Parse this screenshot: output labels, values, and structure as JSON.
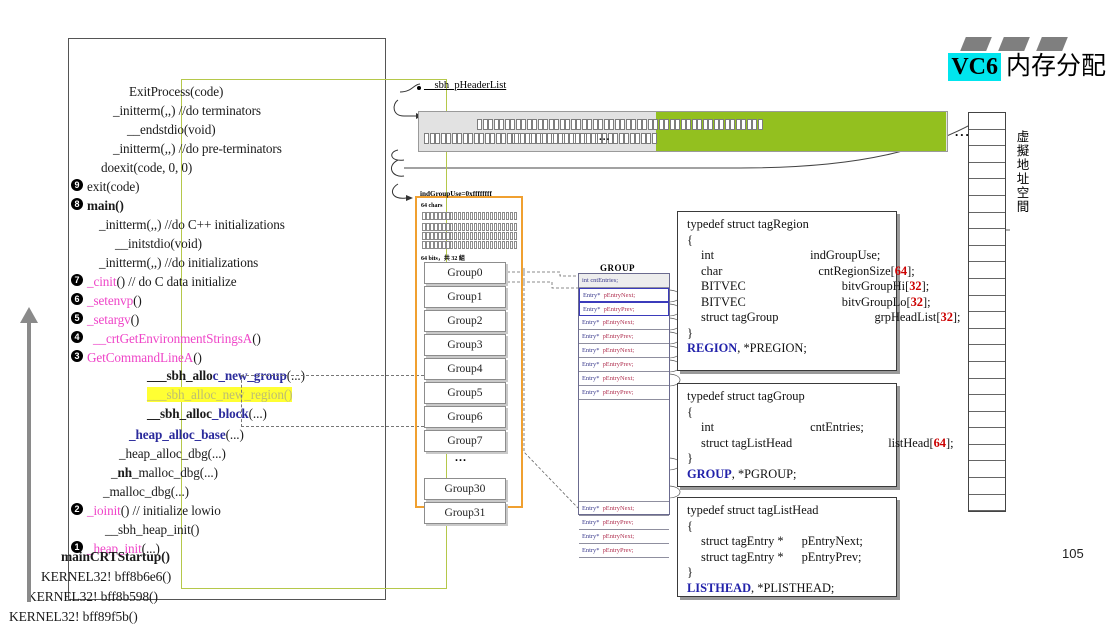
{
  "title": {
    "badge": "VC6",
    "text": "内存分配"
  },
  "page_number": "105",
  "callstack": {
    "lines": [
      {
        "text": "ExitProcess(code)",
        "indent": 60,
        "marker": ""
      },
      {
        "text": "_initterm(,,)   //do terminators",
        "indent": 44,
        "marker": ""
      },
      {
        "text": "__endstdio(void)",
        "indent": 58,
        "marker": ""
      },
      {
        "text": "_initterm(,,)   //do pre-terminators",
        "indent": 44,
        "marker": ""
      },
      {
        "text": "doexit(code, 0, 0)",
        "indent": 32,
        "marker": ""
      },
      {
        "text": "exit(code)",
        "indent": 18,
        "marker": "9"
      },
      {
        "text": "main()",
        "indent": 18,
        "marker": "8"
      },
      {
        "text": "_initterm(,,)  //do C++ initializations",
        "indent": 30,
        "marker": ""
      },
      {
        "text": "__initstdio(void)",
        "indent": 46,
        "marker": ""
      },
      {
        "text": "_initterm(,,)  //do initializations",
        "indent": 30,
        "marker": ""
      },
      {
        "text": "_cinit()  // do C data initialize",
        "indent": 18,
        "marker": "7"
      },
      {
        "text": "_setenvp()",
        "indent": 18,
        "marker": "6"
      },
      {
        "text": "_setargv()",
        "indent": 18,
        "marker": "5"
      },
      {
        "text": "__crtGetEnvironmentStringsA()",
        "indent": 24,
        "marker": "4"
      },
      {
        "text": "GetCommandLineA()",
        "indent": 18,
        "marker": "3"
      },
      {
        "text": "___sbh_alloc_new_group(...)",
        "indent": 78,
        "marker": ""
      },
      {
        "text": "___sbh_alloc_new_region()",
        "indent": 78,
        "marker": ""
      },
      {
        "text": "__sbh_alloc_block(...)",
        "indent": 78,
        "marker": ""
      },
      {
        "text": "_heap_alloc_base(...)",
        "indent": 60,
        "marker": ""
      },
      {
        "text": "_heap_alloc_dbg(...)",
        "indent": 50,
        "marker": ""
      },
      {
        "text": "_nh_malloc_dbg(...)",
        "indent": 42,
        "marker": ""
      },
      {
        "text": "_malloc_dbg(...)",
        "indent": 34,
        "marker": ""
      },
      {
        "text": "_ioinit() // initialize lowio",
        "indent": 18,
        "marker": "2"
      },
      {
        "text": "__sbh_heap_init()",
        "indent": 36,
        "marker": ""
      },
      {
        "text": "_heap_init(...)",
        "indent": 18,
        "marker": "1"
      }
    ],
    "outside_lines": [
      "mainCRTStartup()",
      "KERNEL32! bff8b6e6()",
      "KERNEL32! bff8b598()",
      "KERNEL32! bff89f5b()"
    ]
  },
  "header_list": {
    "pointer_label": "__sbh_pHeaderList",
    "dots_mid": "...",
    "dots_right": "... ..."
  },
  "virtual_address_space": {
    "label": "虚擬地址空間"
  },
  "region_box": {
    "ind_group_use": "indGroupUse=0xffffffff",
    "chars_label": "64 chars",
    "bits_label": "64 bits，共 32 組",
    "groups": [
      "Group0",
      "Group1",
      "Group2",
      "Group3",
      "Group4",
      "Group5",
      "Group6",
      "Group7"
    ],
    "ellipsis": "...",
    "groups_tail": [
      "Group30",
      "Group31"
    ]
  },
  "group_table": {
    "title": "GROUP",
    "header": "int  cntEntries;",
    "rows_top": [
      {
        "type": "Entry*",
        "field": "pEntryNext;"
      },
      {
        "type": "Entry*",
        "field": "pEntryPrev;"
      },
      {
        "type": "Entry*",
        "field": "pEntryNext;"
      },
      {
        "type": "Entry*",
        "field": "pEntryPrev;"
      },
      {
        "type": "Entry*",
        "field": "pEntryNext;"
      },
      {
        "type": "Entry*",
        "field": "pEntryPrev;"
      },
      {
        "type": "Entry*",
        "field": "pEntryNext;"
      },
      {
        "type": "Entry*",
        "field": "pEntryPrev;"
      }
    ],
    "rows_bottom": [
      {
        "type": "Entry*",
        "field": "pEntryNext;"
      },
      {
        "type": "Entry*",
        "field": "pEntryPrev;"
      },
      {
        "type": "Entry*",
        "field": "pEntryNext;"
      },
      {
        "type": "Entry*",
        "field": "pEntryPrev;"
      }
    ]
  },
  "structs": {
    "region": {
      "head": "typedef struct tagRegion",
      "open": "{",
      "fields": [
        {
          "type": "int",
          "name": "indGroupUse;",
          "num": ""
        },
        {
          "type": "char",
          "name": "cntRegionSize[",
          "num": "64",
          "tail": "];"
        },
        {
          "type": "BITVEC",
          "name": "bitvGroupHi[",
          "num": "32",
          "tail": "];"
        },
        {
          "type": "BITVEC",
          "name": "bitvGroupLo[",
          "num": "32",
          "tail": "];"
        },
        {
          "type": "struct tagGroup",
          "name": "grpHeadList[",
          "num": "32",
          "tail": "];"
        }
      ],
      "close": "}",
      "typename": "REGION",
      "ptrname": ", *PREGION;"
    },
    "group": {
      "head": "typedef struct tagGroup",
      "open": "{",
      "fields": [
        {
          "type": "int",
          "name": "cntEntries;",
          "num": ""
        },
        {
          "type": "struct tagListHead",
          "name": "listHead[",
          "num": "64",
          "tail": "];"
        }
      ],
      "close": "}",
      "typename": "GROUP",
      "ptrname": ", *PGROUP;"
    },
    "listhead": {
      "head": "typedef struct tagListHead",
      "open": "{",
      "fields": [
        {
          "type": "struct tagEntry *",
          "name": "pEntryNext;",
          "num": ""
        },
        {
          "type": "struct tagEntry *",
          "name": "pEntryPrev;",
          "num": ""
        }
      ],
      "close": "}",
      "typename": "LISTHEAD",
      "ptrname": ", *PLISTHEAD;"
    }
  },
  "colors": {
    "accent_green": "#93c01f",
    "accent_orange": "#f0a030",
    "highlight_yellow": "#ffff33",
    "badge_cyan": "#00e5ee",
    "pink_text": "#ef45c8",
    "blue_text": "#2222aa",
    "red_number": "#cc0000"
  }
}
